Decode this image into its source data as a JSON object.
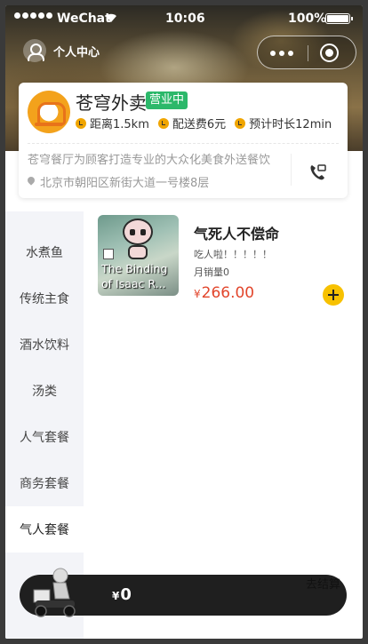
{
  "status_bar": {
    "carrier": "WeChat",
    "time": "10:06",
    "battery": "100%"
  },
  "nav": {
    "user_center": "个人中心"
  },
  "store": {
    "name": "苍穹外卖",
    "status": "营业中",
    "distance": "距离1.5km",
    "delivery_fee": "配送费6元",
    "eta": "预计时长12min",
    "description": "苍穹餐厅为顾客打造专业的大众化美食外送餐饮",
    "address": "北京市朝阳区新街大道一号楼8层"
  },
  "categories": [
    {
      "label": "水煮鱼"
    },
    {
      "label": "传统主食"
    },
    {
      "label": "酒水饮料"
    },
    {
      "label": "汤类"
    },
    {
      "label": "人气套餐"
    },
    {
      "label": "商务套餐"
    },
    {
      "label": "气人套餐"
    }
  ],
  "active_category": "气人套餐",
  "product": {
    "name": "气死人不偿命",
    "description": "吃人啦！！！！！",
    "sales": "月销量0",
    "currency": "¥",
    "price": "266.00",
    "image_caption": "The Binding of Isaac R..."
  },
  "cart": {
    "currency": "¥",
    "total": "0",
    "checkout_label": "去结算"
  },
  "colors": {
    "accent": "#f7c100",
    "open_badge": "#2cb86a",
    "price": "#e2462c",
    "cart_bar": "#1f1f1f"
  },
  "icons": [
    "signal-icon",
    "wifi-icon",
    "battery-icon",
    "user-icon",
    "more-icon",
    "target-icon",
    "location-icon",
    "yen-icon",
    "clock-icon",
    "phone-icon",
    "shortcut-icon",
    "add-icon"
  ]
}
